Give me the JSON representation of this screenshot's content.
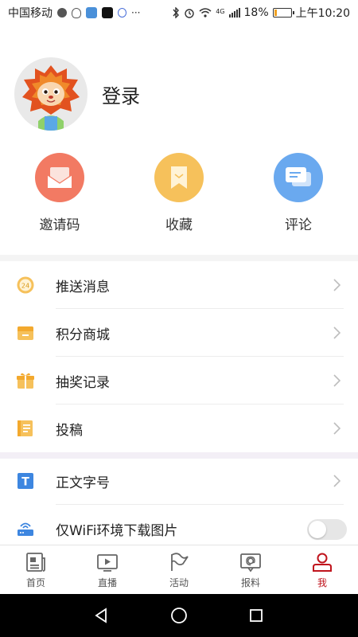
{
  "status_bar": {
    "carrier": "中国移动",
    "network": "4G",
    "battery_text": "18%",
    "battery_level": 0.18,
    "time": "上午10:20",
    "more": "···"
  },
  "profile": {
    "login_label": "登录"
  },
  "quick_actions": [
    {
      "label": "邀请码",
      "icon": "envelope-icon",
      "color": "#f27a63"
    },
    {
      "label": "收藏",
      "icon": "bookmark-icon",
      "color": "#f6c15b"
    },
    {
      "label": "评论",
      "icon": "chat-bubble-icon",
      "color": "#6aa9ef"
    }
  ],
  "menu_group_1": [
    {
      "label": "推送消息",
      "icon": "clock-24-icon",
      "color": "#f3b33a"
    },
    {
      "label": "积分商城",
      "icon": "store-icon",
      "color": "#f3b33a"
    },
    {
      "label": "抽奖记录",
      "icon": "gift-icon",
      "color": "#f3b33a"
    },
    {
      "label": "投稿",
      "icon": "notebook-icon",
      "color": "#f3b33a"
    }
  ],
  "menu_group_2": [
    {
      "label": "正文字号",
      "icon": "text-size-icon",
      "color": "#3d86e0"
    },
    {
      "label": "仅WiFi环境下载图片",
      "icon": "router-icon",
      "color": "#3d86e0",
      "toggle_on": false
    }
  ],
  "tabbar": [
    {
      "label": "首页",
      "icon": "newspaper-icon"
    },
    {
      "label": "直播",
      "icon": "play-screen-icon"
    },
    {
      "label": "活动",
      "icon": "flag-icon"
    },
    {
      "label": "报料",
      "icon": "report-icon"
    },
    {
      "label": "我",
      "icon": "person-icon",
      "active": true
    }
  ],
  "text_size_glyph": "T",
  "accent_color": "#c0141d"
}
